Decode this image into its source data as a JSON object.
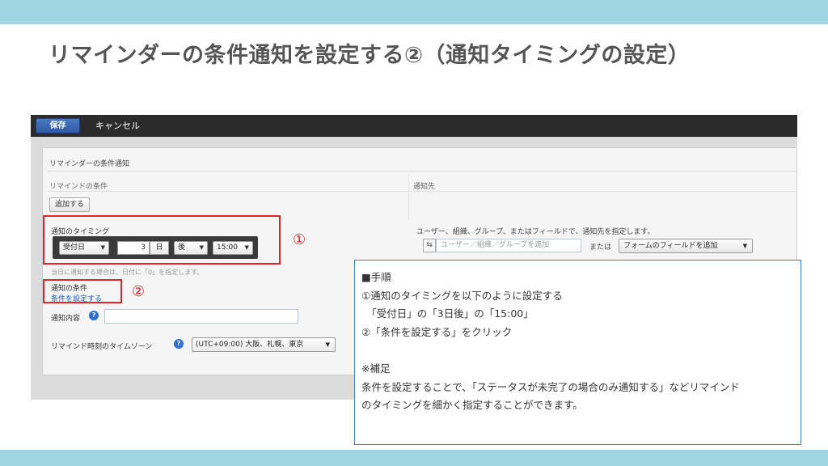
{
  "colors": {
    "band": "#a0d5e2",
    "highlight": "#e0262a",
    "note_border": "#3f7fbf",
    "save_button": "#3a67b5"
  },
  "slide": {
    "title": "リマインダーの条件通知を設定する②（通知タイミングの設定）"
  },
  "toolbar": {
    "save_label": "保存",
    "cancel_label": "キャンセル"
  },
  "panel": {
    "title": "リマインダーの条件通知",
    "col_condition": "リマインドの条件",
    "col_destination": "通知先",
    "add_button": "追加する",
    "timing": {
      "label": "通知のタイミング",
      "base_field": "受付日",
      "offset_value": "3",
      "unit": "日",
      "direction": "後",
      "time": "15:00"
    },
    "hint": "当日に通知する場合は、日付に「0」を指定します。",
    "condition_label": "通知の条件",
    "condition_link": "条件を設定する",
    "content_label": "通知内容",
    "timezone_label": "リマインド時刻のタイムゾーン",
    "timezone_value": "(UTC+09:00) 大阪、札幌、東京"
  },
  "destination": {
    "description": "ユーザー、組織、グループ、またはフィールドで、通知先を指定します。",
    "icon_symbol": "⇆",
    "input_placeholder": "ユーザー／組織／グループを追加",
    "or_label": "または",
    "field_select": "フォームのフィールドを追加"
  },
  "markers": {
    "one": "①",
    "two": "②"
  },
  "note": {
    "lines": [
      "■手順",
      "①通知のタイミングを以下のように設定する",
      "　「受付日」の「3日後」の「15:00」",
      "②「条件を設定する」をクリック",
      "",
      "※補足",
      "条件を設定することで、「ステータスが未完了の場合のみ通知する」などリマインド",
      "のタイミングを細かく指定することができます。"
    ]
  },
  "icons": {
    "help": "question-icon",
    "caret": "caret-down-icon",
    "user_picker": "user-picker-icon"
  }
}
